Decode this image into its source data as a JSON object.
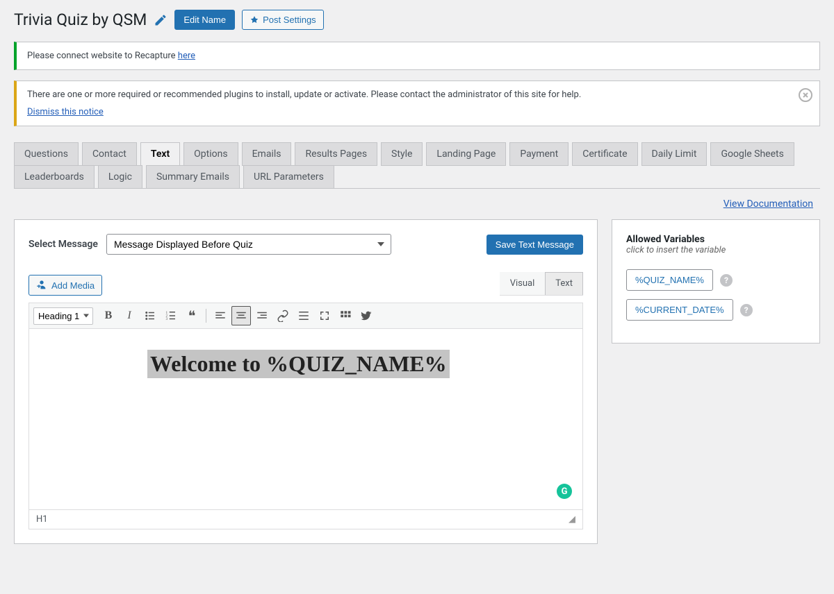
{
  "header": {
    "title": "Trivia Quiz by QSM",
    "edit_name": "Edit Name",
    "post_settings": "Post Settings"
  },
  "notices": {
    "recapture_prefix": "Please connect website to Recapture ",
    "recapture_link": "here",
    "plugins_text": "There are one or more required or recommended plugins to install, update or activate. Please contact the administrator of this site for help.",
    "dismiss": "Dismiss this notice"
  },
  "tabs": {
    "active": "Text",
    "row1": [
      "Questions",
      "Contact",
      "Text",
      "Options",
      "Emails",
      "Results Pages",
      "Style",
      "Landing Page",
      "Payment",
      "Certificate",
      "Daily Limit",
      "Google Sheets"
    ],
    "row2": [
      "Leaderboards",
      "Logic",
      "Summary Emails",
      "URL Parameters"
    ]
  },
  "doc_link": "View Documentation",
  "select": {
    "label": "Select Message",
    "value": "Message Displayed Before Quiz",
    "save": "Save Text Message"
  },
  "editor": {
    "add_media": "Add Media",
    "tab_visual": "Visual",
    "tab_text": "Text",
    "format": "Heading 1",
    "content": "Welcome to %QUIZ_NAME%",
    "status": "H1",
    "grammarly": "G"
  },
  "sidebar": {
    "title": "Allowed Variables",
    "subtitle": "click to insert the variable",
    "vars": [
      "%QUIZ_NAME%",
      "%CURRENT_DATE%"
    ]
  }
}
